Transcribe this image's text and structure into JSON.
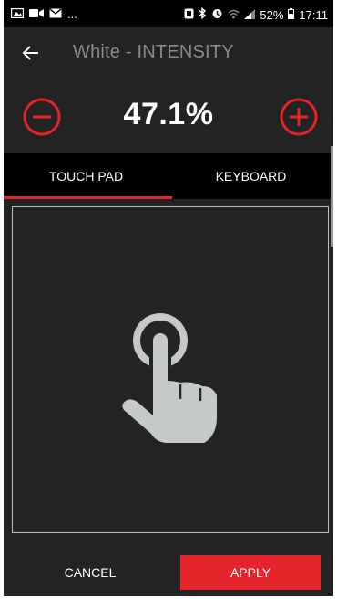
{
  "status_bar": {
    "left_overflow": "...",
    "battery_percent": "52%",
    "time": "17:11"
  },
  "header": {
    "title": "White - INTENSITY"
  },
  "intensity": {
    "value_text": "47.1%"
  },
  "tabs": [
    {
      "label": "TOUCH PAD",
      "active": true
    },
    {
      "label": "KEYBOARD",
      "active": false
    }
  ],
  "footer": {
    "cancel_label": "CANCEL",
    "apply_label": "APPLY"
  },
  "colors": {
    "accent": "#e5242b",
    "background": "#232323",
    "tab_bar": "#000000",
    "title_text": "#8a8a8a",
    "hand_icon": "#c5c9c9"
  },
  "icons": {
    "back": "arrow-left-icon",
    "decrease": "minus-circle-icon",
    "increase": "plus-circle-icon",
    "touch_hint": "touch-hand-icon"
  }
}
